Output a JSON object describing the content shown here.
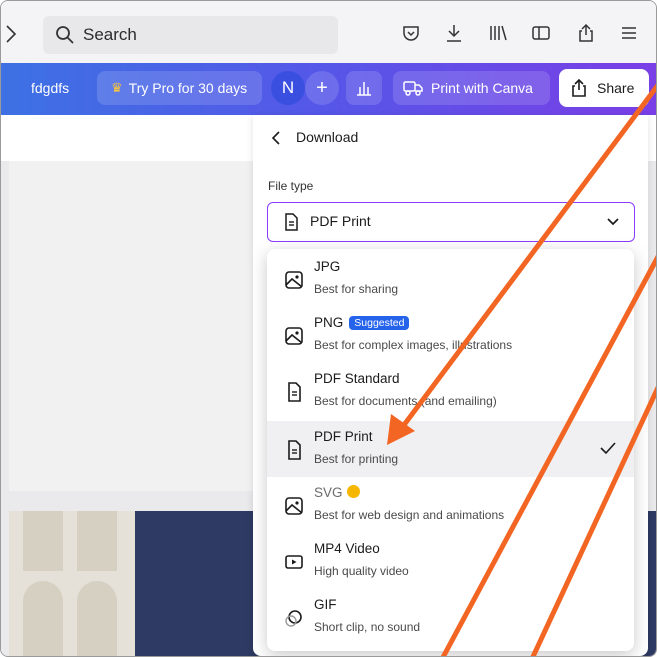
{
  "browser": {
    "search_label": "Search",
    "icons": [
      "star-icon",
      "search-icon",
      "pocket-icon",
      "download-icon",
      "library-icon",
      "sidebar-icon",
      "share-icon",
      "menu-icon"
    ]
  },
  "canva_bar": {
    "design_name": "fdgdfs",
    "try_pro": "Try Pro for 30 days",
    "avatar_initial": "N",
    "plus": "+",
    "print_with_canva": "Print with Canva",
    "share": "Share"
  },
  "panel": {
    "title": "Download",
    "file_type_label": "File type",
    "selected_value": "PDF Print"
  },
  "menu": {
    "items": [
      {
        "title": "JPG",
        "subtitle": "Best for sharing",
        "icon": "image-icon"
      },
      {
        "title": "PNG",
        "badge": "Suggested",
        "subtitle": "Best for complex images, illustrations",
        "icon": "image-icon"
      },
      {
        "title": "PDF Standard",
        "subtitle": "Best for documents (and emailing)",
        "icon": "document-icon"
      },
      {
        "title": "PDF Print",
        "subtitle": "Best for printing",
        "icon": "document-icon",
        "selected": true
      },
      {
        "title": "SVG",
        "subtitle": "Best for web design and animations",
        "icon": "image-icon",
        "pro": true
      },
      {
        "title": "MP4 Video",
        "subtitle": "High quality video",
        "icon": "video-icon"
      },
      {
        "title": "GIF",
        "subtitle": "Short clip, no sound",
        "icon": "gif-icon"
      }
    ]
  },
  "colors": {
    "accent": "#8b3dff",
    "annotation_arrow": "#f26522",
    "badge_blue": "#2563eb",
    "crown_gold": "#f5b700"
  }
}
